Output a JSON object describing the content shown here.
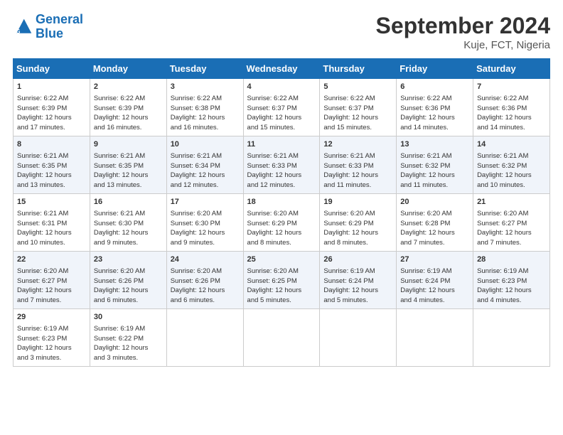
{
  "header": {
    "logo_line1": "General",
    "logo_line2": "Blue",
    "month": "September 2024",
    "location": "Kuje, FCT, Nigeria"
  },
  "days_of_week": [
    "Sunday",
    "Monday",
    "Tuesday",
    "Wednesday",
    "Thursday",
    "Friday",
    "Saturday"
  ],
  "weeks": [
    [
      {
        "day": "1",
        "lines": [
          "Sunrise: 6:22 AM",
          "Sunset: 6:39 PM",
          "Daylight: 12 hours",
          "and 17 minutes."
        ]
      },
      {
        "day": "2",
        "lines": [
          "Sunrise: 6:22 AM",
          "Sunset: 6:39 PM",
          "Daylight: 12 hours",
          "and 16 minutes."
        ]
      },
      {
        "day": "3",
        "lines": [
          "Sunrise: 6:22 AM",
          "Sunset: 6:38 PM",
          "Daylight: 12 hours",
          "and 16 minutes."
        ]
      },
      {
        "day": "4",
        "lines": [
          "Sunrise: 6:22 AM",
          "Sunset: 6:37 PM",
          "Daylight: 12 hours",
          "and 15 minutes."
        ]
      },
      {
        "day": "5",
        "lines": [
          "Sunrise: 6:22 AM",
          "Sunset: 6:37 PM",
          "Daylight: 12 hours",
          "and 15 minutes."
        ]
      },
      {
        "day": "6",
        "lines": [
          "Sunrise: 6:22 AM",
          "Sunset: 6:36 PM",
          "Daylight: 12 hours",
          "and 14 minutes."
        ]
      },
      {
        "day": "7",
        "lines": [
          "Sunrise: 6:22 AM",
          "Sunset: 6:36 PM",
          "Daylight: 12 hours",
          "and 14 minutes."
        ]
      }
    ],
    [
      {
        "day": "8",
        "lines": [
          "Sunrise: 6:21 AM",
          "Sunset: 6:35 PM",
          "Daylight: 12 hours",
          "and 13 minutes."
        ]
      },
      {
        "day": "9",
        "lines": [
          "Sunrise: 6:21 AM",
          "Sunset: 6:35 PM",
          "Daylight: 12 hours",
          "and 13 minutes."
        ]
      },
      {
        "day": "10",
        "lines": [
          "Sunrise: 6:21 AM",
          "Sunset: 6:34 PM",
          "Daylight: 12 hours",
          "and 12 minutes."
        ]
      },
      {
        "day": "11",
        "lines": [
          "Sunrise: 6:21 AM",
          "Sunset: 6:33 PM",
          "Daylight: 12 hours",
          "and 12 minutes."
        ]
      },
      {
        "day": "12",
        "lines": [
          "Sunrise: 6:21 AM",
          "Sunset: 6:33 PM",
          "Daylight: 12 hours",
          "and 11 minutes."
        ]
      },
      {
        "day": "13",
        "lines": [
          "Sunrise: 6:21 AM",
          "Sunset: 6:32 PM",
          "Daylight: 12 hours",
          "and 11 minutes."
        ]
      },
      {
        "day": "14",
        "lines": [
          "Sunrise: 6:21 AM",
          "Sunset: 6:32 PM",
          "Daylight: 12 hours",
          "and 10 minutes."
        ]
      }
    ],
    [
      {
        "day": "15",
        "lines": [
          "Sunrise: 6:21 AM",
          "Sunset: 6:31 PM",
          "Daylight: 12 hours",
          "and 10 minutes."
        ]
      },
      {
        "day": "16",
        "lines": [
          "Sunrise: 6:21 AM",
          "Sunset: 6:30 PM",
          "Daylight: 12 hours",
          "and 9 minutes."
        ]
      },
      {
        "day": "17",
        "lines": [
          "Sunrise: 6:20 AM",
          "Sunset: 6:30 PM",
          "Daylight: 12 hours",
          "and 9 minutes."
        ]
      },
      {
        "day": "18",
        "lines": [
          "Sunrise: 6:20 AM",
          "Sunset: 6:29 PM",
          "Daylight: 12 hours",
          "and 8 minutes."
        ]
      },
      {
        "day": "19",
        "lines": [
          "Sunrise: 6:20 AM",
          "Sunset: 6:29 PM",
          "Daylight: 12 hours",
          "and 8 minutes."
        ]
      },
      {
        "day": "20",
        "lines": [
          "Sunrise: 6:20 AM",
          "Sunset: 6:28 PM",
          "Daylight: 12 hours",
          "and 7 minutes."
        ]
      },
      {
        "day": "21",
        "lines": [
          "Sunrise: 6:20 AM",
          "Sunset: 6:27 PM",
          "Daylight: 12 hours",
          "and 7 minutes."
        ]
      }
    ],
    [
      {
        "day": "22",
        "lines": [
          "Sunrise: 6:20 AM",
          "Sunset: 6:27 PM",
          "Daylight: 12 hours",
          "and 7 minutes."
        ]
      },
      {
        "day": "23",
        "lines": [
          "Sunrise: 6:20 AM",
          "Sunset: 6:26 PM",
          "Daylight: 12 hours",
          "and 6 minutes."
        ]
      },
      {
        "day": "24",
        "lines": [
          "Sunrise: 6:20 AM",
          "Sunset: 6:26 PM",
          "Daylight: 12 hours",
          "and 6 minutes."
        ]
      },
      {
        "day": "25",
        "lines": [
          "Sunrise: 6:20 AM",
          "Sunset: 6:25 PM",
          "Daylight: 12 hours",
          "and 5 minutes."
        ]
      },
      {
        "day": "26",
        "lines": [
          "Sunrise: 6:19 AM",
          "Sunset: 6:24 PM",
          "Daylight: 12 hours",
          "and 5 minutes."
        ]
      },
      {
        "day": "27",
        "lines": [
          "Sunrise: 6:19 AM",
          "Sunset: 6:24 PM",
          "Daylight: 12 hours",
          "and 4 minutes."
        ]
      },
      {
        "day": "28",
        "lines": [
          "Sunrise: 6:19 AM",
          "Sunset: 6:23 PM",
          "Daylight: 12 hours",
          "and 4 minutes."
        ]
      }
    ],
    [
      {
        "day": "29",
        "lines": [
          "Sunrise: 6:19 AM",
          "Sunset: 6:23 PM",
          "Daylight: 12 hours",
          "and 3 minutes."
        ]
      },
      {
        "day": "30",
        "lines": [
          "Sunrise: 6:19 AM",
          "Sunset: 6:22 PM",
          "Daylight: 12 hours",
          "and 3 minutes."
        ]
      },
      {
        "day": "",
        "lines": []
      },
      {
        "day": "",
        "lines": []
      },
      {
        "day": "",
        "lines": []
      },
      {
        "day": "",
        "lines": []
      },
      {
        "day": "",
        "lines": []
      }
    ]
  ]
}
